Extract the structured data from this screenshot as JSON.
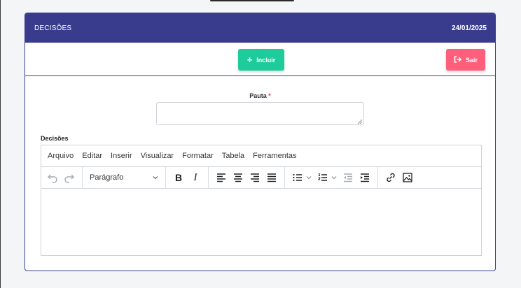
{
  "header": {
    "title": "DECISÕES",
    "date": "24/01/2025"
  },
  "actions": {
    "incluir_label": "Incluir",
    "sair_label": "Sair"
  },
  "form": {
    "pauta_label": "Pauta",
    "pauta_required_mark": "*",
    "pauta_value": "",
    "decisoes_label": "Decisões"
  },
  "editor": {
    "menu": [
      "Arquivo",
      "Editar",
      "Inserir",
      "Visualizar",
      "Formatar",
      "Tabela",
      "Ferramentas"
    ],
    "block_format": "Parágrafo",
    "tools": {
      "undo": "undo-icon",
      "redo": "redo-icon",
      "bold": "bold-icon",
      "italic": "italic-icon",
      "align_left": "align-left-icon",
      "align_center": "align-center-icon",
      "align_right": "align-right-icon",
      "align_justify": "align-justify-icon",
      "bullet_list": "bullet-list-icon",
      "numbered_list": "numbered-list-icon",
      "outdent": "outdent-icon",
      "indent": "indent-icon",
      "link": "link-icon",
      "image": "image-icon"
    },
    "content": ""
  },
  "colors": {
    "header_bg": "#393c8d",
    "incluir_bg": "#1ecb9a",
    "sair_bg": "#ff5f7a",
    "required": "#e0334a"
  }
}
